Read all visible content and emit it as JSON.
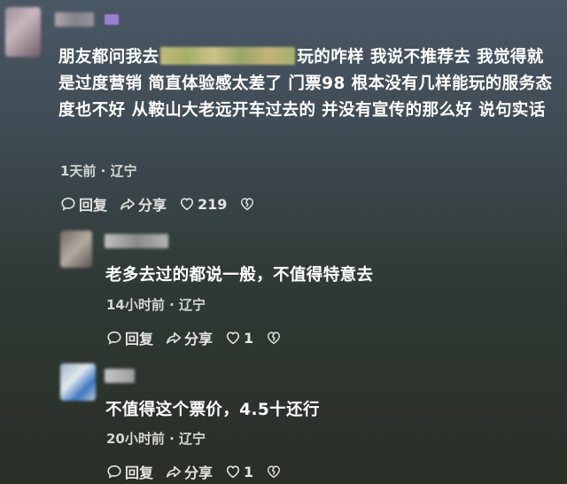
{
  "comments": [
    {
      "text_before": "朋友都问我去",
      "text_after": "玩的咋样 我说不推荐去 我觉得就是过度营销 简直体验感太差了 门票98 根本没有几样能玩的服务态度也不好  从鞍山大老远开车过去的 并没有宣传的那么好 说句实话",
      "time": "1天前",
      "location": "辽宁",
      "reply_label": "回复",
      "share_label": "分享",
      "likes": "219"
    },
    {
      "text": "老多去过的都说一般，不值得特意去",
      "time": "14小时前",
      "location": "辽宁",
      "reply_label": "回复",
      "share_label": "分享",
      "likes": "1"
    },
    {
      "text": "不值得这个票价，4.5十还行",
      "time": "20小时前",
      "location": "辽宁",
      "reply_label": "回复",
      "share_label": "分享",
      "likes": "1"
    }
  ],
  "icons": {
    "reply": "speech-bubble-icon",
    "share": "share-arrow-icon",
    "like": "heart-icon",
    "dislike": "broken-heart-icon"
  },
  "colors": {
    "text": "#ffffff",
    "meta": "#d5d7d3",
    "badge": "#9b7fd1"
  }
}
